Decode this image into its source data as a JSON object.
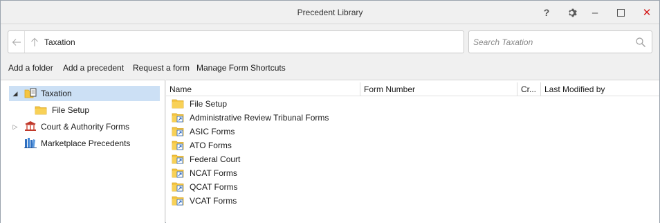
{
  "window": {
    "title": "Precedent Library"
  },
  "titlebar_buttons": {
    "help": "?",
    "minimize": "–",
    "close": "✕"
  },
  "address": {
    "path": "Taxation"
  },
  "search": {
    "placeholder": "Search Taxation"
  },
  "toolbar": {
    "add_folder": "Add a folder",
    "add_precedent": "Add a precedent",
    "request_form": "Request a form",
    "manage_shortcuts": "Manage Form Shortcuts"
  },
  "tree": [
    {
      "label": "Taxation",
      "icon": "folder-document-icon",
      "expanded": true,
      "selected": true
    },
    {
      "label": "File Setup",
      "icon": "folder-icon"
    },
    {
      "label": "Court & Authority Forms",
      "icon": "courthouse-icon",
      "expanded": false
    },
    {
      "label": "Marketplace Precedents",
      "icon": "books-icon"
    }
  ],
  "list": {
    "columns": [
      "Name",
      "Form Number",
      "Cr...",
      "Last Modified by"
    ],
    "rows": [
      {
        "name": "File Setup",
        "icon": "folder-icon"
      },
      {
        "name": "Administrative Review Tribunal Forms",
        "icon": "folder-shortcut-icon"
      },
      {
        "name": "ASIC Forms",
        "icon": "folder-shortcut-icon"
      },
      {
        "name": "ATO Forms",
        "icon": "folder-shortcut-icon"
      },
      {
        "name": "Federal Court",
        "icon": "folder-shortcut-icon"
      },
      {
        "name": "NCAT Forms",
        "icon": "folder-shortcut-icon"
      },
      {
        "name": "QCAT Forms",
        "icon": "folder-shortcut-icon"
      },
      {
        "name": "VCAT Forms",
        "icon": "folder-shortcut-icon"
      }
    ]
  },
  "colors": {
    "selection": "#cce0f5",
    "folder": "#f5c542",
    "close": "#d41c1c",
    "shortcut_arrow": "#1f5fbf"
  }
}
